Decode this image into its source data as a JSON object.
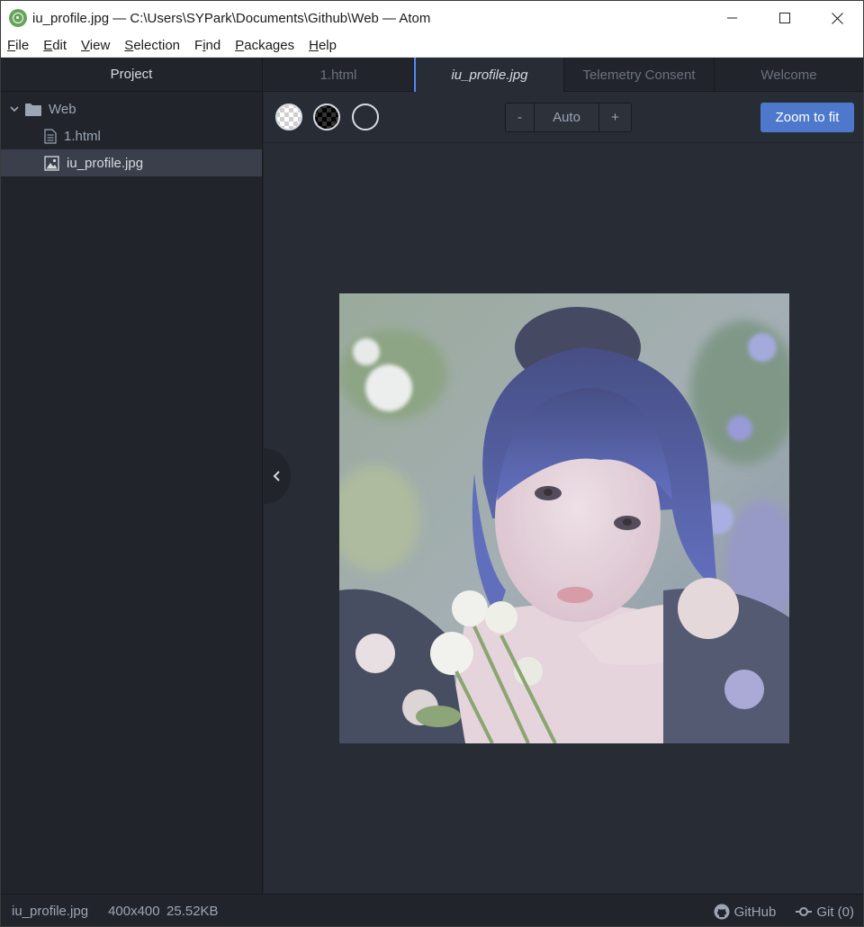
{
  "window": {
    "title": "iu_profile.jpg — C:\\Users\\SYPark\\Documents\\Github\\Web — Atom"
  },
  "menu": [
    {
      "label": "File",
      "accel": "F",
      "rest": "ile"
    },
    {
      "label": "Edit",
      "accel": "E",
      "rest": "dit"
    },
    {
      "label": "View",
      "accel": "V",
      "rest": "iew"
    },
    {
      "label": "Selection",
      "accel": "S",
      "rest": "election"
    },
    {
      "label": "Find",
      "accel": "F",
      "rest": "ind",
      "prefix": ""
    },
    {
      "label": "Packages",
      "accel": "P",
      "rest": "ackages"
    },
    {
      "label": "Help",
      "accel": "H",
      "rest": "elp"
    }
  ],
  "sidebar": {
    "header": "Project",
    "folder": "Web",
    "files": [
      "1.html",
      "iu_profile.jpg"
    ],
    "selected": "iu_profile.jpg"
  },
  "tabs": [
    "1.html",
    "iu_profile.jpg",
    "Telemetry Consent",
    "Welcome"
  ],
  "active_tab": "iu_profile.jpg",
  "toolbar": {
    "zoom_minus": "-",
    "zoom_value": "Auto",
    "zoom_plus": "+",
    "fit_label": "Zoom to fit"
  },
  "status": {
    "filename": "iu_profile.jpg",
    "dimensions": "400x400",
    "size": "25.52KB",
    "github": "GitHub",
    "git": "Git (0)"
  },
  "colors": {
    "accent": "#568af2",
    "fit_button": "#4d78cc",
    "panel": "#21252b",
    "editor": "#282c34"
  }
}
